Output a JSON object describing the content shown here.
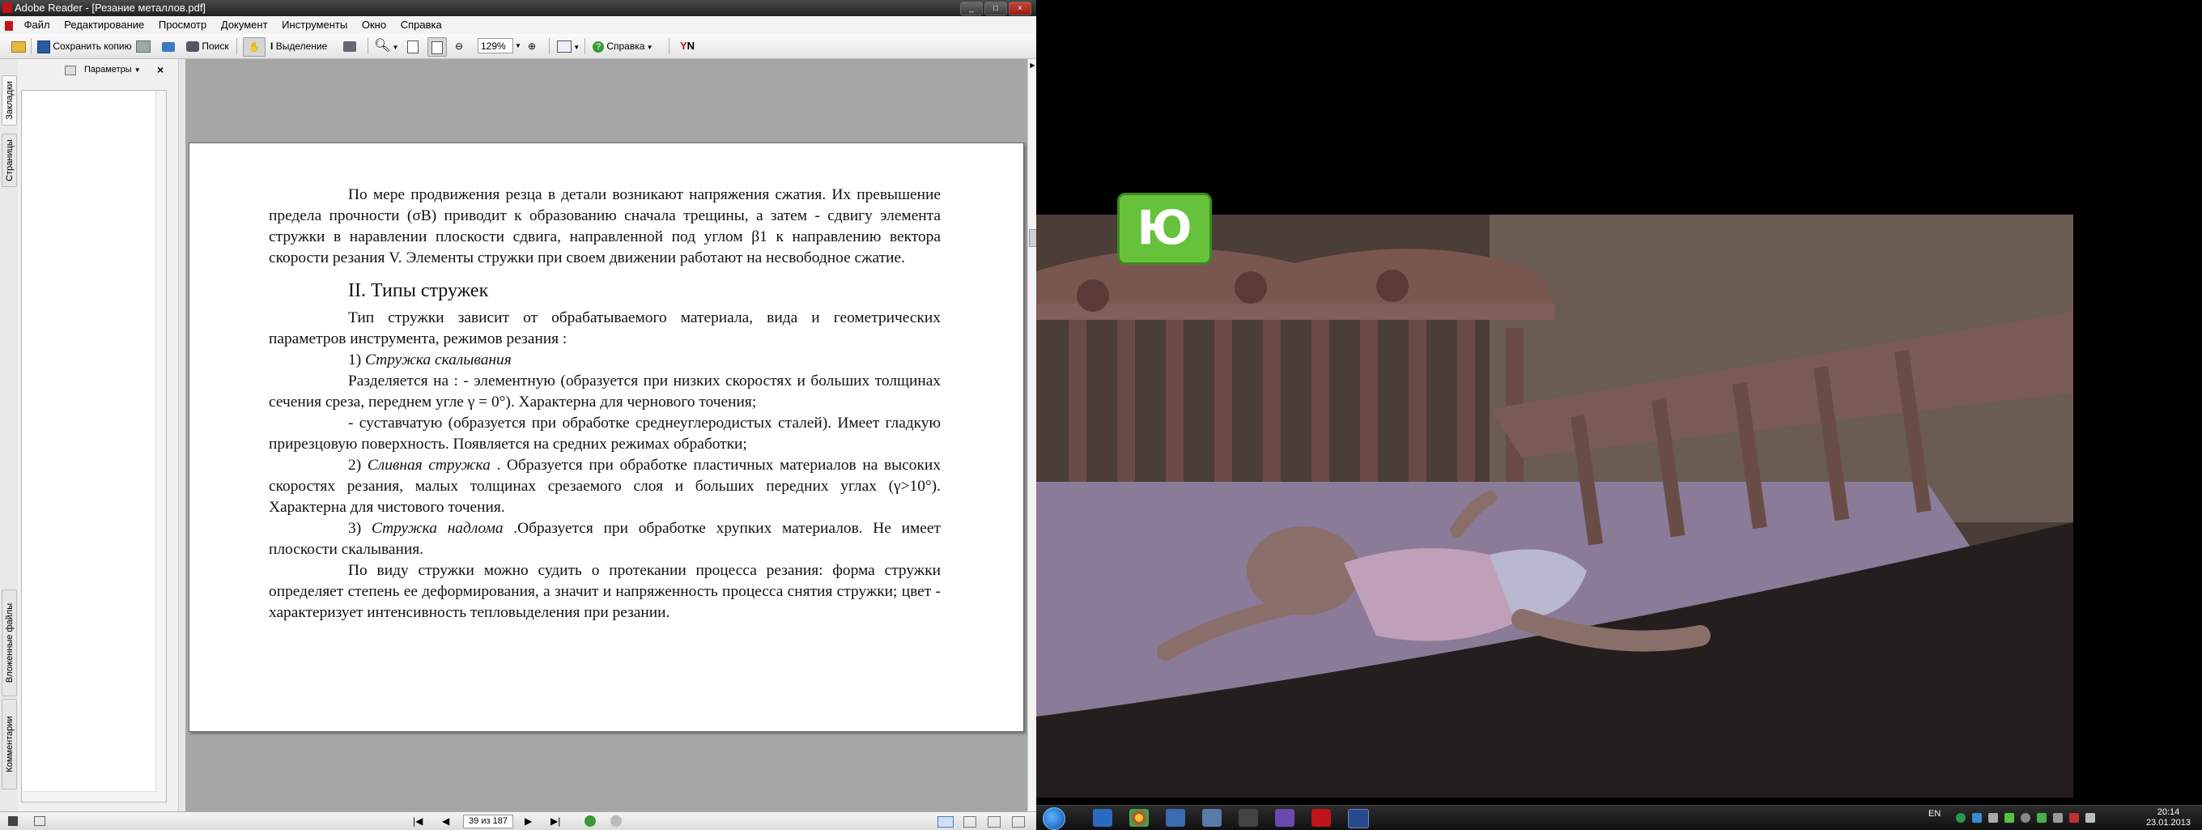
{
  "window": {
    "title": "Adobe Reader - [Резание металлов.pdf]",
    "buttons": [
      "_",
      "□",
      "×"
    ]
  },
  "menu": [
    "Файл",
    "Редактирование",
    "Просмотр",
    "Документ",
    "Инструменты",
    "Окно",
    "Справка"
  ],
  "toolbar": {
    "save_copy": "Сохранить копию",
    "search": "Поиск",
    "select": "Выделение",
    "zoom": "129%",
    "help": "Справка"
  },
  "nav_tabs": [
    "Закладки",
    "Страницы",
    "Вложенные файлы",
    "Комментарии"
  ],
  "bookmarks_panel": {
    "options": "Параметры"
  },
  "document": {
    "para1": "По мере продвижения резца в детали возникают напряжения сжатия. Их превышение предела прочности (σB) приводит к образованию сначала трещины, а затем - сдвигу элемента стружки в наравлении плоскости сдвига, направленной под углом β1 к направлению вектора скорости резания V. Элементы стружки при своем движении работают на несвободное сжатие.",
    "heading": "II. Типы стружек",
    "para2": "Тип стружки зависит от обрабатываемого материала, вида и геометрических параметров инструмента, режимов резания :",
    "item1_num": "1) ",
    "item1_title": "Стружка скалывания",
    "para3": "Разделяется на : - элементную (образуется при низких скоростях и больших толщинах сечения среза, переднем угле γ = 0°). Характерна для чернового точения;",
    "para4": "- суставчатую (образуется при обработке среднеуглеродистых сталей). Имеет гладкую прирезцовую поверхность. Появляется на средних режимах обработки;",
    "item2_num": "2) ",
    "item2_title": "Сливная стружка",
    "item2_text": " . Образуется при обработке пластичных материалов на высоких скоростях резания, малых толщинах срезаемого слоя и больших передних углах (γ>10°). Характерна для чистового точения.",
    "item3_num": "3) ",
    "item3_title": "Стружка надлома",
    "item3_text": " .Образуется при обработке хрупких материалов. Не имеет плоскости скалывания.",
    "para5": "По виду стружки можно судить о протекании процесса резания: форма стружки определяет степень ее деформирования, а значит и напряженность процесса снятия стружки; цвет - характеризует интенсивность тепловыделения при резании."
  },
  "status": {
    "page": "39 из 187"
  },
  "video": {
    "channel_logo": "Ю"
  },
  "taskbar": {
    "lang": "EN",
    "time": "20:14",
    "date": "23.01.2013"
  },
  "colors": {
    "doc_bg": "#a6a6a6",
    "logo_green": "#66c23a",
    "taskbar": "#1a1a1a"
  }
}
